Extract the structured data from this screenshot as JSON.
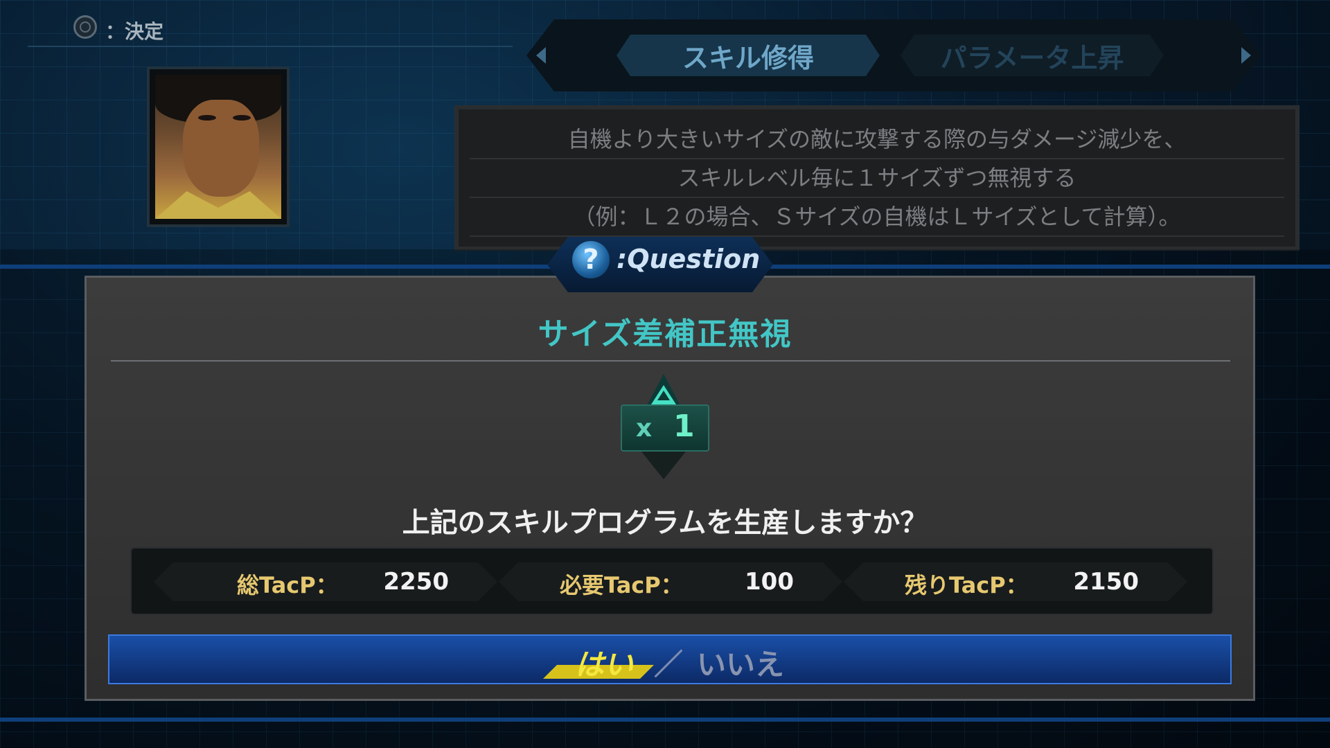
{
  "hint": {
    "text": "：決定",
    "icon": "circle-button-icon"
  },
  "tabs": [
    {
      "label": "スキル修得",
      "active": true
    },
    {
      "label": "パラメータ上昇",
      "active": false
    }
  ],
  "description": {
    "lines": [
      "自機より大きいサイズの敵に攻撃する際の与ダメージ減少を、",
      "スキルレベル毎に１サイズずつ無視する",
      "（例：Ｌ２の場合、Ｓサイズの自機はＬサイズとして計算）。"
    ]
  },
  "dialog": {
    "badge": ":Question",
    "skill_name": "サイズ差補正無視",
    "count_prefix": "x",
    "count_value": "1",
    "question": "上記のスキルプログラムを生産しますか？",
    "tacp": [
      {
        "label": "総TacP：",
        "value": "2250"
      },
      {
        "label": "必要TacP：",
        "value": "100"
      },
      {
        "label": "残りTacP：",
        "value": "2150"
      }
    ],
    "yes": "はい",
    "separator": "／",
    "no": "いいえ"
  },
  "colors": {
    "skill_title": "#43c6c6",
    "tacp_label": "#e6c870",
    "yes": "#f4e840",
    "choice_bar": "#1a4fa8"
  }
}
